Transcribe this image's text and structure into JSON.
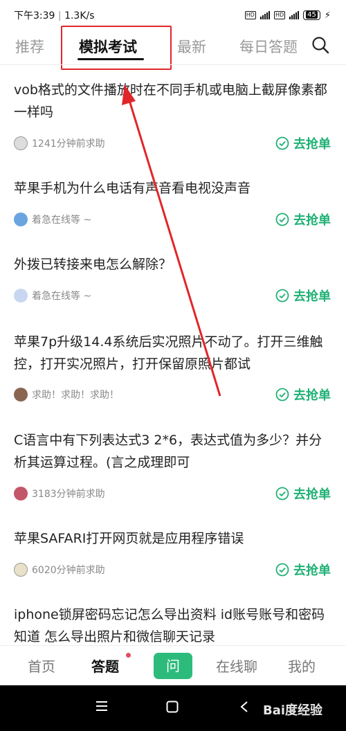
{
  "status": {
    "time": "下午3:39",
    "speed": "1.3K/s",
    "battery": "45"
  },
  "tabs": {
    "recommend": "推荐",
    "mock_exam": "模拟考试",
    "latest": "最新",
    "daily": "每日答题"
  },
  "questions": [
    {
      "title": "vob格式的文件播放时在不同手机或电脑上截屏像素都一样吗",
      "meta": "1241分钟前求助",
      "action": "去抢单"
    },
    {
      "title": "苹果手机为什么电话有声音看电视没声音",
      "meta": "着急在线等 ~",
      "action": "去抢单"
    },
    {
      "title": "外拨已转接来电怎么解除？",
      "meta": "着急在线等 ~",
      "action": "去抢单"
    },
    {
      "title": "苹果7p升级14.4系统后实况照片不动了。打开三维触控，打开实况照片，打开保留原照片都试",
      "meta": "求助！求助！求助！",
      "action": "去抢单"
    },
    {
      "title": "C语言中有下列表达式3 2*6，表达式值为多少？并分析其运算过程。(言之成理即可",
      "meta": "3183分钟前求助",
      "action": "去抢单"
    },
    {
      "title": "苹果SAFARI打开网页就是应用程序错误",
      "meta": "6020分钟前求助",
      "action": "去抢单"
    },
    {
      "title": "iphone锁屏密码忘记怎么导出资料 id账号账号和密码知道 怎么导出照片和微信聊天记录",
      "meta": "",
      "action": ""
    }
  ],
  "bottom_nav": {
    "home": "首页",
    "answer": "答题",
    "ask": "问",
    "chat": "在线聊",
    "mine": "我的"
  },
  "watermark": "Bai度经验",
  "colors": {
    "accent": "#1fb074",
    "annotation": "#e0262a"
  }
}
